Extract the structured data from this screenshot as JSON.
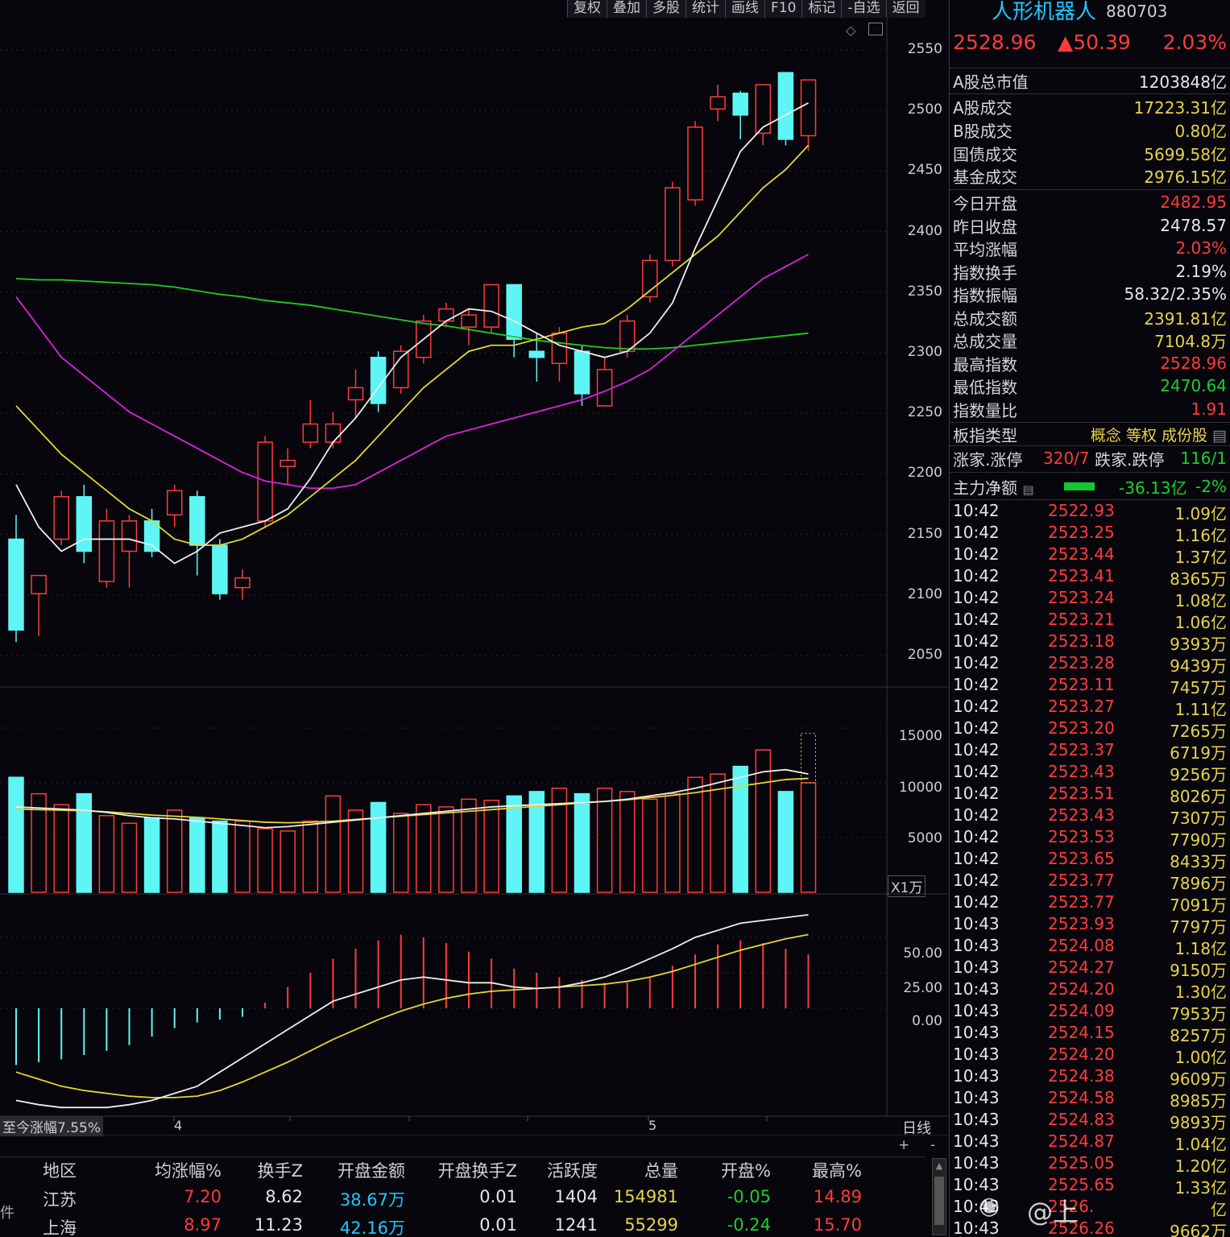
{
  "toolbar": {
    "items": [
      "复权",
      "叠加",
      "多股",
      "统计",
      "画线",
      "F10",
      "标记",
      "-自选",
      "返回"
    ]
  },
  "price_axis": [
    "2550",
    "2500",
    "2450",
    "2400",
    "2350",
    "2300",
    "2250",
    "2200",
    "2150",
    "2100",
    "2050"
  ],
  "volume_axis": [
    "15000",
    "10000",
    "5000"
  ],
  "volume_unit": "X1万",
  "macd_axis": [
    "50.00",
    "25.00",
    "0.00"
  ],
  "date_axis": {
    "left_note": "至今涨幅7.55%",
    "m4": "4",
    "m5": "5",
    "period": "日线",
    "plus": "+",
    "minus": "-"
  },
  "chart_data": {
    "type": "candlestick",
    "ylim": [
      2030,
      2575
    ],
    "candles": [
      {
        "o": 2150,
        "h": 2170,
        "l": 2065,
        "c": 2075
      },
      {
        "o": 2105,
        "h": 2120,
        "l": 2070,
        "c": 2120
      },
      {
        "o": 2150,
        "h": 2190,
        "l": 2145,
        "c": 2185
      },
      {
        "o": 2185,
        "h": 2195,
        "l": 2130,
        "c": 2140
      },
      {
        "o": 2115,
        "h": 2175,
        "l": 2110,
        "c": 2165
      },
      {
        "o": 2140,
        "h": 2170,
        "l": 2110,
        "c": 2165
      },
      {
        "o": 2165,
        "h": 2175,
        "l": 2135,
        "c": 2140
      },
      {
        "o": 2170,
        "h": 2195,
        "l": 2160,
        "c": 2190
      },
      {
        "o": 2185,
        "h": 2190,
        "l": 2120,
        "c": 2145
      },
      {
        "o": 2145,
        "h": 2150,
        "l": 2100,
        "c": 2105
      },
      {
        "o": 2110,
        "h": 2125,
        "l": 2100,
        "c": 2118
      },
      {
        "o": 2165,
        "h": 2235,
        "l": 2160,
        "c": 2230
      },
      {
        "o": 2210,
        "h": 2225,
        "l": 2195,
        "c": 2215
      },
      {
        "o": 2230,
        "h": 2265,
        "l": 2225,
        "c": 2245
      },
      {
        "o": 2230,
        "h": 2255,
        "l": 2225,
        "c": 2245
      },
      {
        "o": 2265,
        "h": 2290,
        "l": 2250,
        "c": 2275
      },
      {
        "o": 2300,
        "h": 2305,
        "l": 2255,
        "c": 2262
      },
      {
        "o": 2275,
        "h": 2310,
        "l": 2270,
        "c": 2305
      },
      {
        "o": 2300,
        "h": 2335,
        "l": 2295,
        "c": 2330
      },
      {
        "o": 2330,
        "h": 2345,
        "l": 2325,
        "c": 2340
      },
      {
        "o": 2325,
        "h": 2340,
        "l": 2310,
        "c": 2335
      },
      {
        "o": 2325,
        "h": 2360,
        "l": 2320,
        "c": 2360
      },
      {
        "o": 2360,
        "h": 2360,
        "l": 2300,
        "c": 2315
      },
      {
        "o": 2305,
        "h": 2320,
        "l": 2280,
        "c": 2300
      },
      {
        "o": 2295,
        "h": 2325,
        "l": 2280,
        "c": 2320
      },
      {
        "o": 2305,
        "h": 2310,
        "l": 2260,
        "c": 2270
      },
      {
        "o": 2260,
        "h": 2300,
        "l": 2260,
        "c": 2290
      },
      {
        "o": 2305,
        "h": 2335,
        "l": 2300,
        "c": 2330
      },
      {
        "o": 2350,
        "h": 2385,
        "l": 2345,
        "c": 2380
      },
      {
        "o": 2380,
        "h": 2445,
        "l": 2375,
        "c": 2440
      },
      {
        "o": 2430,
        "h": 2495,
        "l": 2425,
        "c": 2490
      },
      {
        "o": 2505,
        "h": 2525,
        "l": 2495,
        "c": 2515
      },
      {
        "o": 2518,
        "h": 2520,
        "l": 2480,
        "c": 2500
      },
      {
        "o": 2485,
        "h": 2525,
        "l": 2475,
        "c": 2525
      },
      {
        "o": 2535,
        "h": 2535,
        "l": 2475,
        "c": 2480
      },
      {
        "o": 2482.95,
        "h": 2528.96,
        "l": 2470.64,
        "c": 2528.96
      }
    ],
    "ma_white": [
      2195,
      2160,
      2140,
      2150,
      2150,
      2150,
      2145,
      2130,
      2140,
      2155,
      2160,
      2165,
      2175,
      2200,
      2230,
      2250,
      2275,
      2300,
      2315,
      2330,
      2340,
      2338,
      2330,
      2320,
      2310,
      2305,
      2300,
      2305,
      2320,
      2345,
      2390,
      2430,
      2470,
      2490,
      2500,
      2510
    ],
    "ma_yellow": [
      2260,
      2240,
      2220,
      2205,
      2190,
      2175,
      2165,
      2150,
      2145,
      2145,
      2150,
      2160,
      2170,
      2185,
      2200,
      2215,
      2235,
      2255,
      2275,
      2290,
      2305,
      2310,
      2310,
      2315,
      2320,
      2325,
      2328,
      2340,
      2355,
      2370,
      2385,
      2400,
      2420,
      2440,
      2455,
      2475
    ],
    "ma_magenta": [
      2350,
      2325,
      2300,
      2285,
      2270,
      2255,
      2245,
      2235,
      2225,
      2215,
      2205,
      2198,
      2195,
      2192,
      2192,
      2195,
      2205,
      2215,
      2225,
      2235,
      2240,
      2245,
      2250,
      2255,
      2260,
      2265,
      2272,
      2280,
      2290,
      2305,
      2320,
      2335,
      2350,
      2365,
      2375,
      2385
    ],
    "ma_green": [
      2365,
      2364,
      2364,
      2363,
      2362,
      2361,
      2360,
      2358,
      2355,
      2352,
      2350,
      2347,
      2345,
      2343,
      2340,
      2337,
      2334,
      2331,
      2328,
      2326,
      2323,
      2320,
      2317,
      2314,
      2312,
      2310,
      2308,
      2307,
      2307,
      2308,
      2310,
      2312,
      2314,
      2316,
      2318,
      2320
    ],
    "volume": [
      10500,
      9000,
      8000,
      9000,
      7000,
      6300,
      6800,
      7500,
      6800,
      6500,
      6500,
      5800,
      5600,
      6500,
      8800,
      7500,
      8200,
      7200,
      8000,
      7800,
      8500,
      8400,
      8800,
      9200,
      9500,
      9000,
      9500,
      9200,
      8500,
      9000,
      10500,
      10800,
      11500,
      13000,
      9200,
      10000
    ],
    "volume_ylim": [
      0,
      17500
    ],
    "vol_ma_white": [
      7800,
      7700,
      7600,
      7500,
      7300,
      7000,
      6800,
      6700,
      6500,
      6300,
      6100,
      5900,
      6000,
      6200,
      6400,
      6600,
      6800,
      7000,
      7200,
      7400,
      7600,
      7800,
      7900,
      8000,
      8100,
      8200,
      8300,
      8500,
      8800,
      9100,
      9500,
      10000,
      10500,
      11000,
      11200,
      10800
    ],
    "vol_ma_yellow": [
      7600,
      7550,
      7500,
      7450,
      7350,
      7200,
      7050,
      6950,
      6850,
      6700,
      6550,
      6400,
      6350,
      6400,
      6500,
      6650,
      6800,
      6950,
      7100,
      7250,
      7400,
      7550,
      7700,
      7850,
      8000,
      8150,
      8300,
      8450,
      8650,
      8850,
      9100,
      9400,
      9700,
      10000,
      10300,
      10400
    ],
    "macd_hist": [
      -40,
      -38,
      -36,
      -33,
      -30,
      -26,
      -20,
      -14,
      -10,
      -8,
      -6,
      4,
      15,
      25,
      35,
      42,
      48,
      52,
      50,
      46,
      40,
      35,
      28,
      25,
      22,
      20,
      18,
      18,
      22,
      30,
      38,
      45,
      48,
      46,
      42,
      38
    ],
    "macd_dif": [
      -65,
      -68,
      -70,
      -70,
      -70,
      -68,
      -65,
      -60,
      -55,
      -45,
      -35,
      -25,
      -15,
      -5,
      5,
      10,
      15,
      20,
      22,
      20,
      18,
      18,
      15,
      14,
      15,
      18,
      22,
      28,
      35,
      42,
      50,
      55,
      60,
      62,
      64,
      66
    ],
    "macd_dea": [
      -45,
      -50,
      -55,
      -58,
      -60,
      -62,
      -63,
      -63,
      -62,
      -58,
      -52,
      -45,
      -38,
      -30,
      -22,
      -15,
      -8,
      -2,
      3,
      7,
      10,
      12,
      13,
      14,
      15,
      16,
      17,
      19,
      22,
      26,
      31,
      36,
      41,
      45,
      49,
      52
    ],
    "macd_ylim": [
      -75,
      75
    ]
  },
  "side": {
    "name": "人形机器人",
    "code": "880703",
    "price": "2528.96",
    "change": "▲50.39",
    "change_pct": "2.03%",
    "rows1": [
      {
        "label": "A股总市值",
        "value": "1203848亿"
      },
      {
        "label": "A股成交",
        "value": "17223.31亿"
      },
      {
        "label": "B股成交",
        "value": "0.80亿"
      },
      {
        "label": "国债成交",
        "value": "5699.58亿"
      },
      {
        "label": "基金成交",
        "value": "2976.15亿"
      }
    ],
    "rows2": [
      {
        "label": "今日开盘",
        "value": "2482.95"
      },
      {
        "label": "昨日收盘",
        "value": "2478.57"
      },
      {
        "label": "平均涨幅",
        "value": "2.03%"
      },
      {
        "label": "指数换手",
        "value": "2.19%"
      },
      {
        "label": "指数振幅",
        "value": "58.32/2.35%"
      },
      {
        "label": "总成交额",
        "value": "2391.81亿"
      },
      {
        "label": "总成交量",
        "value": "7104.8万"
      },
      {
        "label": "最高指数",
        "value": "2528.96"
      },
      {
        "label": "最低指数",
        "value": "2470.64"
      },
      {
        "label": "指数量比",
        "value": "1.91"
      }
    ],
    "type_label": "板指类型",
    "type_value": "概念 等权 成份股",
    "up_label": "涨家.涨停",
    "up_value": "320/7",
    "down_label": "跌家.跌停",
    "down_value": "116/1",
    "main_label": "主力净额",
    "main_value": "-36.13亿",
    "main_pct": "-2%",
    "ticks": [
      {
        "t": "10:42",
        "p": "2522.93",
        "v": "1.09亿"
      },
      {
        "t": "10:42",
        "p": "2523.25",
        "v": "1.16亿"
      },
      {
        "t": "10:42",
        "p": "2523.44",
        "v": "1.37亿"
      },
      {
        "t": "10:42",
        "p": "2523.41",
        "v": "8365万"
      },
      {
        "t": "10:42",
        "p": "2523.24",
        "v": "1.08亿"
      },
      {
        "t": "10:42",
        "p": "2523.21",
        "v": "1.06亿"
      },
      {
        "t": "10:42",
        "p": "2523.18",
        "v": "9393万"
      },
      {
        "t": "10:42",
        "p": "2523.28",
        "v": "9439万"
      },
      {
        "t": "10:42",
        "p": "2523.11",
        "v": "7457万"
      },
      {
        "t": "10:42",
        "p": "2523.27",
        "v": "1.11亿"
      },
      {
        "t": "10:42",
        "p": "2523.20",
        "v": "7265万"
      },
      {
        "t": "10:42",
        "p": "2523.37",
        "v": "6719万"
      },
      {
        "t": "10:42",
        "p": "2523.43",
        "v": "9256万"
      },
      {
        "t": "10:42",
        "p": "2523.51",
        "v": "8026万"
      },
      {
        "t": "10:42",
        "p": "2523.43",
        "v": "7307万"
      },
      {
        "t": "10:42",
        "p": "2523.53",
        "v": "7790万"
      },
      {
        "t": "10:42",
        "p": "2523.65",
        "v": "8433万"
      },
      {
        "t": "10:42",
        "p": "2523.77",
        "v": "7896万"
      },
      {
        "t": "10:42",
        "p": "2523.77",
        "v": "7091万"
      },
      {
        "t": "10:43",
        "p": "2523.93",
        "v": "7797万"
      },
      {
        "t": "10:43",
        "p": "2524.08",
        "v": "1.18亿"
      },
      {
        "t": "10:43",
        "p": "2524.27",
        "v": "9150万"
      },
      {
        "t": "10:43",
        "p": "2524.20",
        "v": "1.30亿"
      },
      {
        "t": "10:43",
        "p": "2524.09",
        "v": "7953万"
      },
      {
        "t": "10:43",
        "p": "2524.15",
        "v": "8257万"
      },
      {
        "t": "10:43",
        "p": "2524.20",
        "v": "1.00亿"
      },
      {
        "t": "10:43",
        "p": "2524.38",
        "v": "9609万"
      },
      {
        "t": "10:43",
        "p": "2524.58",
        "v": "8985万"
      },
      {
        "t": "10:43",
        "p": "2524.83",
        "v": "9893万"
      },
      {
        "t": "10:43",
        "p": "2524.87",
        "v": "1.04亿"
      },
      {
        "t": "10:43",
        "p": "2525.05",
        "v": "1.20亿"
      },
      {
        "t": "10:43",
        "p": "2525.65",
        "v": "1.33亿"
      },
      {
        "t": "10:43",
        "p": "2526.",
        "v": "亿"
      },
      {
        "t": "10:43",
        "p": "2526.26",
        "v": "9662万"
      }
    ],
    "watermark": "@上"
  },
  "table": {
    "headers": [
      "地区",
      "均涨幅%",
      "换手Z",
      "开盘金额",
      "开盘换手Z",
      "活跃度",
      "总量",
      "开盘%",
      "最高%"
    ],
    "rows": [
      {
        "region": "江苏",
        "avg": "7.20",
        "turn": "8.62",
        "open_amt": "38.67万",
        "open_turn": "0.01",
        "active": "1404",
        "total": "154981",
        "open_pct": "-0.05",
        "high_pct": "14.89"
      },
      {
        "region": "上海",
        "avg": "8.97",
        "turn": "11.23",
        "open_amt": "42.16万",
        "open_turn": "0.01",
        "active": "1241",
        "total": "55299",
        "open_pct": "-0.24",
        "high_pct": "15.70"
      }
    ],
    "side_tab": "件"
  }
}
